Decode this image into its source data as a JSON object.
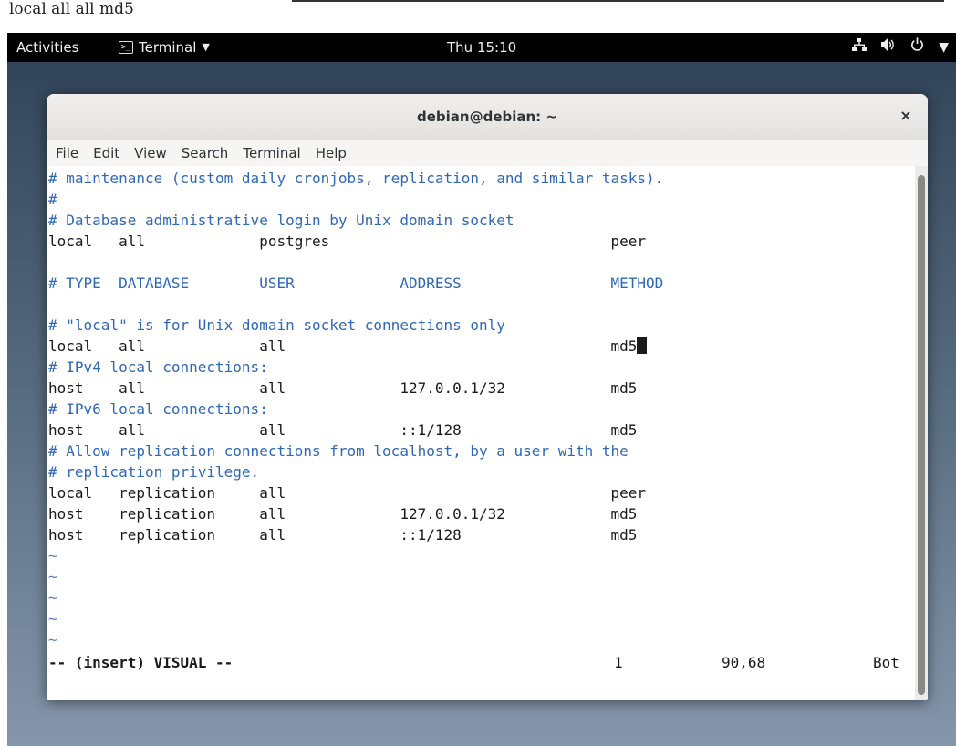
{
  "caption": "local all all md5",
  "topbar": {
    "activities": "Activities",
    "app_menu": "Terminal",
    "clock": "Thu 15:10"
  },
  "window": {
    "title": "debian@debian: ~",
    "close_glyph": "×"
  },
  "menu": [
    "File",
    "Edit",
    "View",
    "Search",
    "Terminal",
    "Help"
  ],
  "terminal": {
    "lines": [
      "# maintenance (custom daily cronjobs, replication, and similar tasks).",
      "#",
      "# Database administrative login by Unix domain socket",
      "local   all             postgres                                peer",
      "",
      "# TYPE  DATABASE        USER            ADDRESS                 METHOD",
      "",
      "# \"local\" is for Unix domain socket connections only",
      "local   all             all                                     md5",
      "# IPv4 local connections:",
      "host    all             all             127.0.0.1/32            md5",
      "# IPv6 local connections:",
      "host    all             all             ::1/128                 md5",
      "# Allow replication connections from localhost, by a user with the",
      "# replication privilege.",
      "local   replication     all                                     peer",
      "host    replication     all             127.0.0.1/32            md5",
      "host    replication     all             ::1/128                 md5",
      "~",
      "~",
      "~",
      "~",
      "~"
    ],
    "status_mode": "-- (insert) VISUAL --",
    "status_count": "1",
    "status_pos": "90,68",
    "status_scroll": "Bot"
  },
  "icons": {
    "terminal_app": "terminal-icon",
    "network": "network-icon",
    "volume": "volume-icon",
    "power": "power-icon"
  }
}
